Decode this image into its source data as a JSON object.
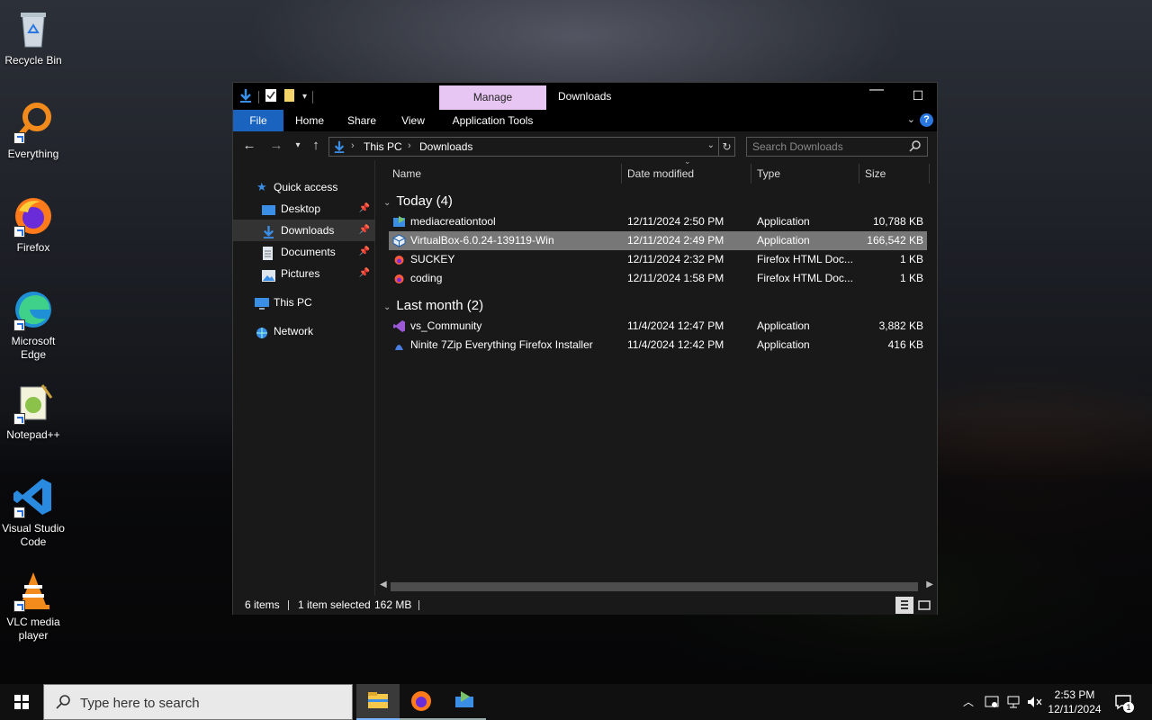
{
  "desktop": {
    "icons": [
      {
        "label": "Recycle Bin"
      },
      {
        "label": "Everything"
      },
      {
        "label": "Firefox"
      },
      {
        "label": "Microsoft Edge"
      },
      {
        "label": "Notepad++"
      },
      {
        "label": "Visual Studio Code"
      },
      {
        "label": "VLC media player"
      }
    ]
  },
  "window": {
    "title": "Downloads",
    "context_tab": "Manage",
    "ribbon_tabs": [
      "File",
      "Home",
      "Share",
      "View",
      "Application Tools"
    ],
    "controls": {
      "minimize": "—",
      "maximize": "☐",
      "close": "✕"
    },
    "help": "?"
  },
  "address": {
    "crumbs": [
      "This PC",
      "Downloads"
    ]
  },
  "search": {
    "placeholder": "Search Downloads"
  },
  "navpane": {
    "items": [
      {
        "label": "Quick access"
      },
      {
        "label": "Desktop",
        "pinned": true
      },
      {
        "label": "Downloads",
        "pinned": true,
        "selected": true
      },
      {
        "label": "Documents",
        "pinned": true
      },
      {
        "label": "Pictures",
        "pinned": true
      },
      {
        "label": "This PC"
      },
      {
        "label": "Network"
      }
    ]
  },
  "columns": {
    "name": "Name",
    "date": "Date modified",
    "type": "Type",
    "size": "Size"
  },
  "groups": [
    {
      "title": "Today (4)",
      "files": [
        {
          "name": "mediacreationtool",
          "date": "12/11/2024 2:50 PM",
          "type": "Application",
          "size": "10,788 KB"
        },
        {
          "name": "VirtualBox-6.0.24-139119-Win",
          "date": "12/11/2024 2:49 PM",
          "type": "Application",
          "size": "166,542 KB",
          "selected": true
        },
        {
          "name": "SUCKEY",
          "date": "12/11/2024 2:32 PM",
          "type": "Firefox HTML Doc...",
          "size": "1 KB"
        },
        {
          "name": "coding",
          "date": "12/11/2024 1:58 PM",
          "type": "Firefox HTML Doc...",
          "size": "1 KB"
        }
      ]
    },
    {
      "title": "Last month (2)",
      "files": [
        {
          "name": "vs_Community",
          "date": "11/4/2024 12:47 PM",
          "type": "Application",
          "size": "3,882 KB"
        },
        {
          "name": "Ninite 7Zip Everything Firefox Installer",
          "date": "11/4/2024 12:42 PM",
          "type": "Application",
          "size": "416 KB"
        }
      ]
    }
  ],
  "status": {
    "count": "6 items",
    "selected": "1 item selected",
    "size": "162 MB"
  },
  "taskbar": {
    "search_placeholder": "Type here to search",
    "time": "2:53 PM",
    "date": "12/11/2024",
    "notification_count": "1"
  },
  "colors": {
    "file_tab": "#1a64c0",
    "manage_tab": "#e8c6f3",
    "selected_row": "#777777",
    "accent": "#2a77e0"
  }
}
